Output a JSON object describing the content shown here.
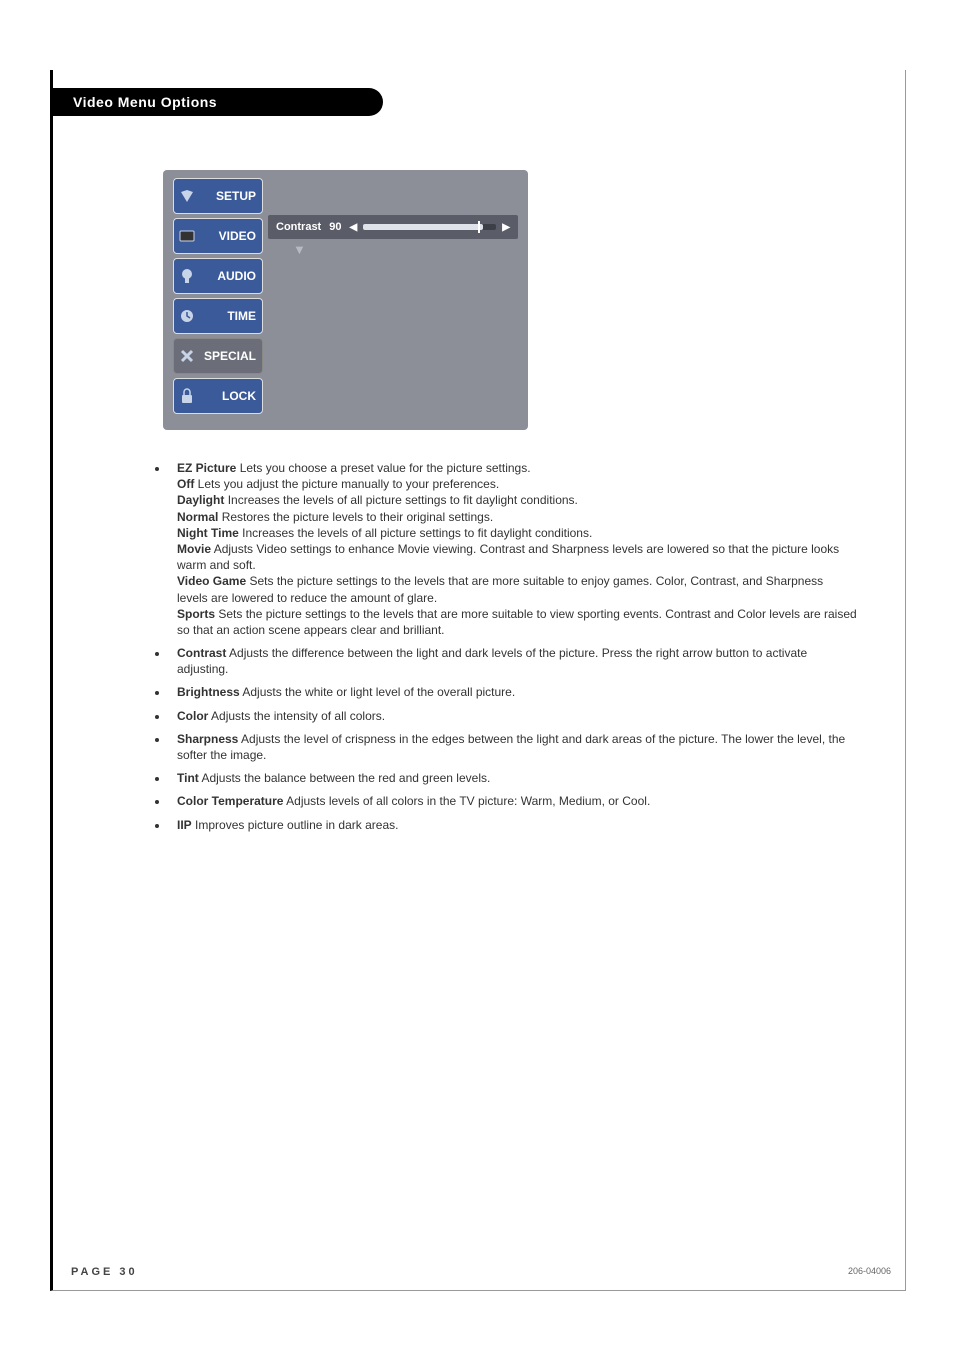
{
  "header": {
    "title": "Video Menu Options"
  },
  "osd": {
    "tabs": [
      {
        "label": "SETUP",
        "icon": "setup-icon"
      },
      {
        "label": "VIDEO",
        "icon": "video-icon"
      },
      {
        "label": "AUDIO",
        "icon": "audio-icon"
      },
      {
        "label": "TIME",
        "icon": "time-icon"
      },
      {
        "label": "SPECIAL",
        "icon": "special-icon"
      },
      {
        "label": "LOCK",
        "icon": "lock-icon"
      }
    ],
    "slider": {
      "label": "Contrast",
      "value": "90",
      "arrow_left": "◀",
      "arrow_right": "▶",
      "arrow_down": "▼"
    }
  },
  "descriptions": {
    "items": [
      {
        "title": "EZ Picture",
        "text": "Lets you choose a preset value for the picture settings.",
        "sub": [
          {
            "name": "Off",
            "text": "Lets you adjust the picture manually to your preferences."
          },
          {
            "name": "Daylight",
            "text": "Increases the levels of all picture settings to fit daylight conditions."
          },
          {
            "name": "Normal",
            "text": "Restores the picture levels to their original settings."
          },
          {
            "name": "Night Time",
            "text": "Increases the levels of all picture settings to fit daylight conditions."
          },
          {
            "name": "Movie",
            "text": "Adjusts Video settings to enhance Movie viewing. Contrast and Sharpness levels are lowered so that the picture looks warm and soft."
          },
          {
            "name": "Video Game",
            "text": "Sets the picture settings to the levels that are more suitable to enjoy games. Color, Contrast, and Sharpness levels are lowered to reduce the amount of glare."
          },
          {
            "name": "Sports",
            "text": "Sets the picture settings to the levels that are more suitable to view sporting events. Contrast and Color levels are raised so that an action scene appears clear and brilliant."
          }
        ]
      },
      {
        "title": "Contrast",
        "text": "Adjusts the difference between the light and dark levels of the picture. Press the right arrow button to activate adjusting."
      },
      {
        "title": "Brightness",
        "text": "Adjusts the white or light level of the overall picture."
      },
      {
        "title": "Color",
        "text": "Adjusts the intensity of all colors."
      },
      {
        "title": "Sharpness",
        "text": "Adjusts the level of crispness in the edges between the light and dark areas of the picture. The lower the level, the softer the image."
      },
      {
        "title": "Tint",
        "text": "Adjusts the balance between the red and green levels."
      },
      {
        "title": "Color Temperature",
        "text": "Adjusts levels of all colors in the TV picture: Warm, Medium, or Cool."
      },
      {
        "title": "IIP",
        "text": "Improves picture outline in dark areas."
      }
    ]
  },
  "footer": {
    "page": "PAGE 30",
    "docnum": "206-04006"
  }
}
